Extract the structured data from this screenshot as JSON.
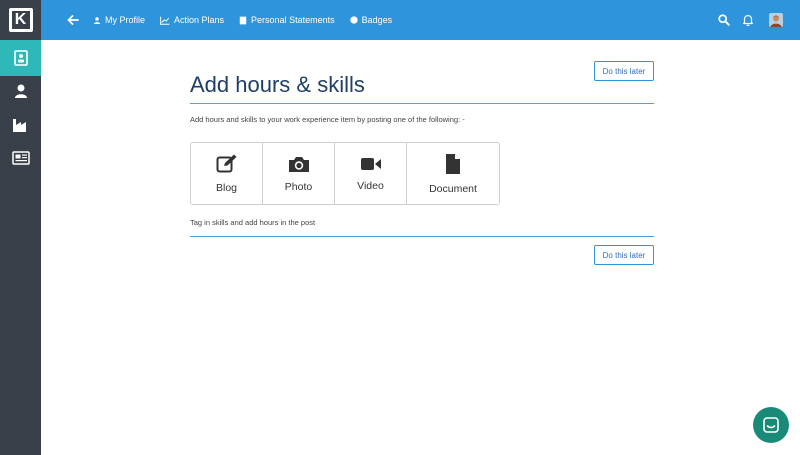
{
  "brand": {
    "logo_letter": "K"
  },
  "topnav": {
    "items": [
      {
        "label": "My Profile",
        "icon": "user-icon"
      },
      {
        "label": "Action Plans",
        "icon": "chart-line-icon"
      },
      {
        "label": "Personal Statements",
        "icon": "document-icon"
      },
      {
        "label": "Badges",
        "icon": "badge-icon"
      }
    ]
  },
  "sidebar": {
    "items": [
      {
        "name": "portfolio",
        "icon": "id-card-icon",
        "active": true
      },
      {
        "name": "profile",
        "icon": "user-icon"
      },
      {
        "name": "employers",
        "icon": "factory-icon"
      },
      {
        "name": "news",
        "icon": "newspaper-icon"
      }
    ]
  },
  "main": {
    "title": "Add hours & skills",
    "later_button": "Do this later",
    "intro": "Add hours and skills to your work experience item by posting one of the following: -",
    "options": [
      {
        "label": "Blog",
        "icon": "edit-icon"
      },
      {
        "label": "Photo",
        "icon": "camera-icon"
      },
      {
        "label": "Video",
        "icon": "video-icon"
      },
      {
        "label": "Document",
        "icon": "file-icon"
      }
    ],
    "tagline": "Tag in skills and add hours in the post",
    "later_button_bottom": "Do this later"
  },
  "colors": {
    "topbar": "#2e95dc",
    "sidebar": "#3a4049",
    "active": "#2eb8b8",
    "title": "#1f3f66",
    "chat": "#1a8a78"
  }
}
